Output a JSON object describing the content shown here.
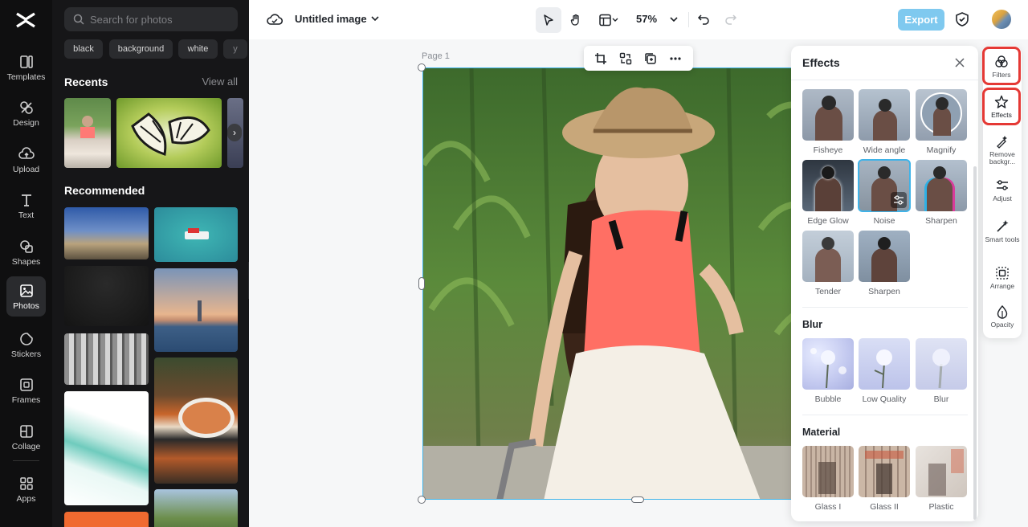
{
  "left_nav": {
    "items": [
      {
        "label": "Templates",
        "icon": "templates-icon"
      },
      {
        "label": "Design",
        "icon": "design-icon"
      },
      {
        "label": "Upload",
        "icon": "upload-icon"
      },
      {
        "label": "Text",
        "icon": "text-icon"
      },
      {
        "label": "Shapes",
        "icon": "shapes-icon"
      },
      {
        "label": "Photos",
        "icon": "photos-icon",
        "active": true
      },
      {
        "label": "Stickers",
        "icon": "stickers-icon"
      },
      {
        "label": "Frames",
        "icon": "frames-icon"
      },
      {
        "label": "Collage",
        "icon": "collage-icon"
      },
      {
        "label": "Apps",
        "icon": "apps-icon"
      }
    ]
  },
  "photos_panel": {
    "search_placeholder": "Search for photos",
    "chips": [
      "black",
      "background",
      "white",
      "y"
    ],
    "recents_title": "Recents",
    "view_all": "View all",
    "recommended_title": "Recommended"
  },
  "topbar": {
    "title": "Untitled image",
    "zoom": "57%",
    "export": "Export"
  },
  "canvas": {
    "page_label": "Page 1"
  },
  "effects_panel": {
    "title": "Effects",
    "portrait_effects": [
      "Fisheye",
      "Wide angle",
      "Magnify",
      "Edge Glow",
      "Noise",
      "Sharpen",
      "Tender",
      "Sharpen"
    ],
    "blur_title": "Blur",
    "blur_effects": [
      "Bubble",
      "Low Quality",
      "Blur"
    ],
    "material_title": "Material",
    "material_effects": [
      "Glass I",
      "Glass II",
      "Plastic"
    ]
  },
  "right_tools": {
    "filters": "Filters",
    "effects": "Effects",
    "remove_bg": "Remove backgr...",
    "adjust": "Adjust",
    "smart_tools": "Smart tools",
    "arrange": "Arrange",
    "opacity": "Opacity"
  },
  "colors": {
    "accent": "#3fb3e8",
    "export_button": "#7fc9ef",
    "highlight_box": "#e53935",
    "nav_bg": "#0f0f10",
    "panel_bg": "#161618"
  }
}
